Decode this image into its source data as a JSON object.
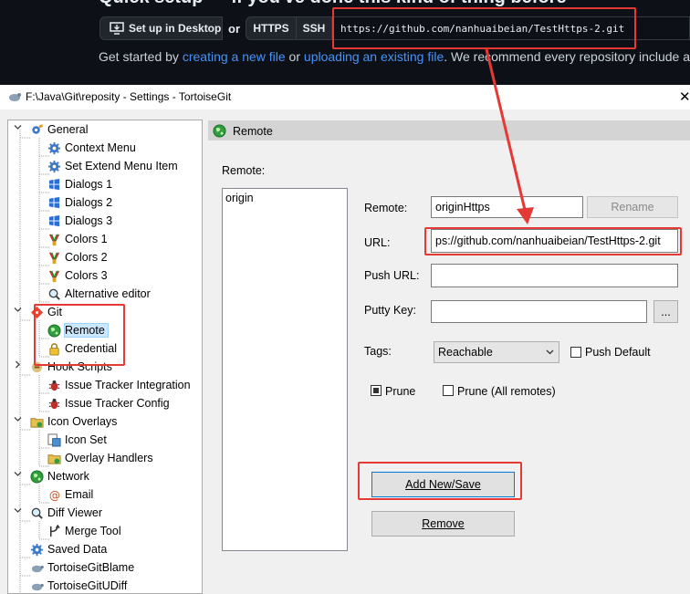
{
  "github": {
    "heading": "Quick setup — if you've done this kind of thing before",
    "desktop_button": "Set up in Desktop",
    "or": "or",
    "https_tab": "HTTPS",
    "ssh_tab": "SSH",
    "clone_url": "https://github.com/nanhuaibeian/TestHttps-2.git",
    "started_prefix": "Get started by ",
    "link_create": "creating a new file",
    "started_mid": " or ",
    "link_upload": "uploading an existing file",
    "started_suffix": ". We recommend every repository include a"
  },
  "window": {
    "title": "F:\\Java\\Git\\reposity - Settings - TortoiseGit",
    "close": "✕"
  },
  "tree": {
    "items": [
      {
        "label": "General"
      },
      {
        "label": "Context Menu"
      },
      {
        "label": "Set Extend Menu Item"
      },
      {
        "label": "Dialogs 1"
      },
      {
        "label": "Dialogs 2"
      },
      {
        "label": "Dialogs 3"
      },
      {
        "label": "Colors 1"
      },
      {
        "label": "Colors 2"
      },
      {
        "label": "Colors 3"
      },
      {
        "label": "Alternative editor"
      },
      {
        "label": "Git"
      },
      {
        "label": "Remote"
      },
      {
        "label": "Credential"
      },
      {
        "label": "Hook Scripts"
      },
      {
        "label": "Issue Tracker Integration"
      },
      {
        "label": "Issue Tracker Config"
      },
      {
        "label": "Icon Overlays"
      },
      {
        "label": "Icon Set"
      },
      {
        "label": "Overlay Handlers"
      },
      {
        "label": "Network"
      },
      {
        "label": "Email"
      },
      {
        "label": "Diff Viewer"
      },
      {
        "label": "Merge Tool"
      },
      {
        "label": "Saved Data"
      },
      {
        "label": "TortoiseGitBlame"
      },
      {
        "label": "TortoiseGitUDiff"
      }
    ]
  },
  "panel": {
    "header": "Remote",
    "remote_list_label": "Remote:",
    "remotes": [
      "origin"
    ],
    "remote_label": "Remote:",
    "remote_value": "originHttps",
    "rename_button": "Rename",
    "url_label": "URL:",
    "url_value": "ps://github.com/nanhuaibeian/TestHttps-2.git",
    "push_url_label": "Push URL:",
    "push_url_value": "",
    "putty_label": "Putty Key:",
    "putty_value": "",
    "browse_button": "...",
    "tags_label": "Tags:",
    "tags_value": "Reachable",
    "push_default_label": "Push Default",
    "push_default_checked": false,
    "prune_label": "Prune",
    "prune_checked": true,
    "prune_all_label": "Prune (All remotes)",
    "prune_all_checked": false,
    "add_save_button": "Add New/Save",
    "remove_button": "Remove"
  },
  "colors": {
    "highlight": "#e53935",
    "github_bg": "#0d1117",
    "github_link": "#4493f8",
    "selection": "#cce8ff"
  }
}
